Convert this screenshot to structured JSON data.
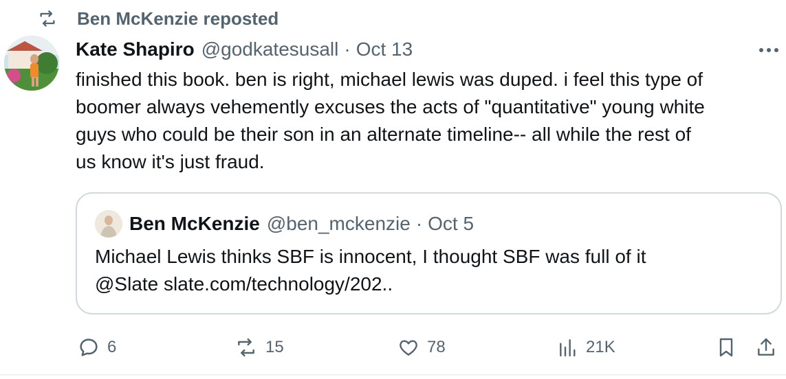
{
  "repost": {
    "label": "Ben McKenzie reposted",
    "icon": "repost-icon"
  },
  "tweet": {
    "author_name": "Kate Shapiro",
    "handle": "@godkatesusall",
    "separator": "·",
    "date": "Oct 13",
    "text_lines": [
      "finished this book. ben is right, michael lewis was duped. i feel this type of",
      "boomer always vehemently excuses the acts of \"quantitative\" young white",
      "guys who could be their son in an alternate timeline-- all while the rest of",
      "us know it's just fraud."
    ]
  },
  "quote": {
    "author_name": "Ben McKenzie",
    "handle": "@ben_mckenzie",
    "separator": "·",
    "date": "Oct 5",
    "text_lines": [
      "Michael Lewis thinks SBF is innocent, I thought SBF was full of it",
      "@Slate slate.com/technology/202.."
    ]
  },
  "actions": {
    "replies": "6",
    "reposts": "15",
    "likes": "78",
    "views": "21K"
  },
  "colors": {
    "text": "#0f1419",
    "secondary": "#536471",
    "border": "#cfd9de"
  }
}
